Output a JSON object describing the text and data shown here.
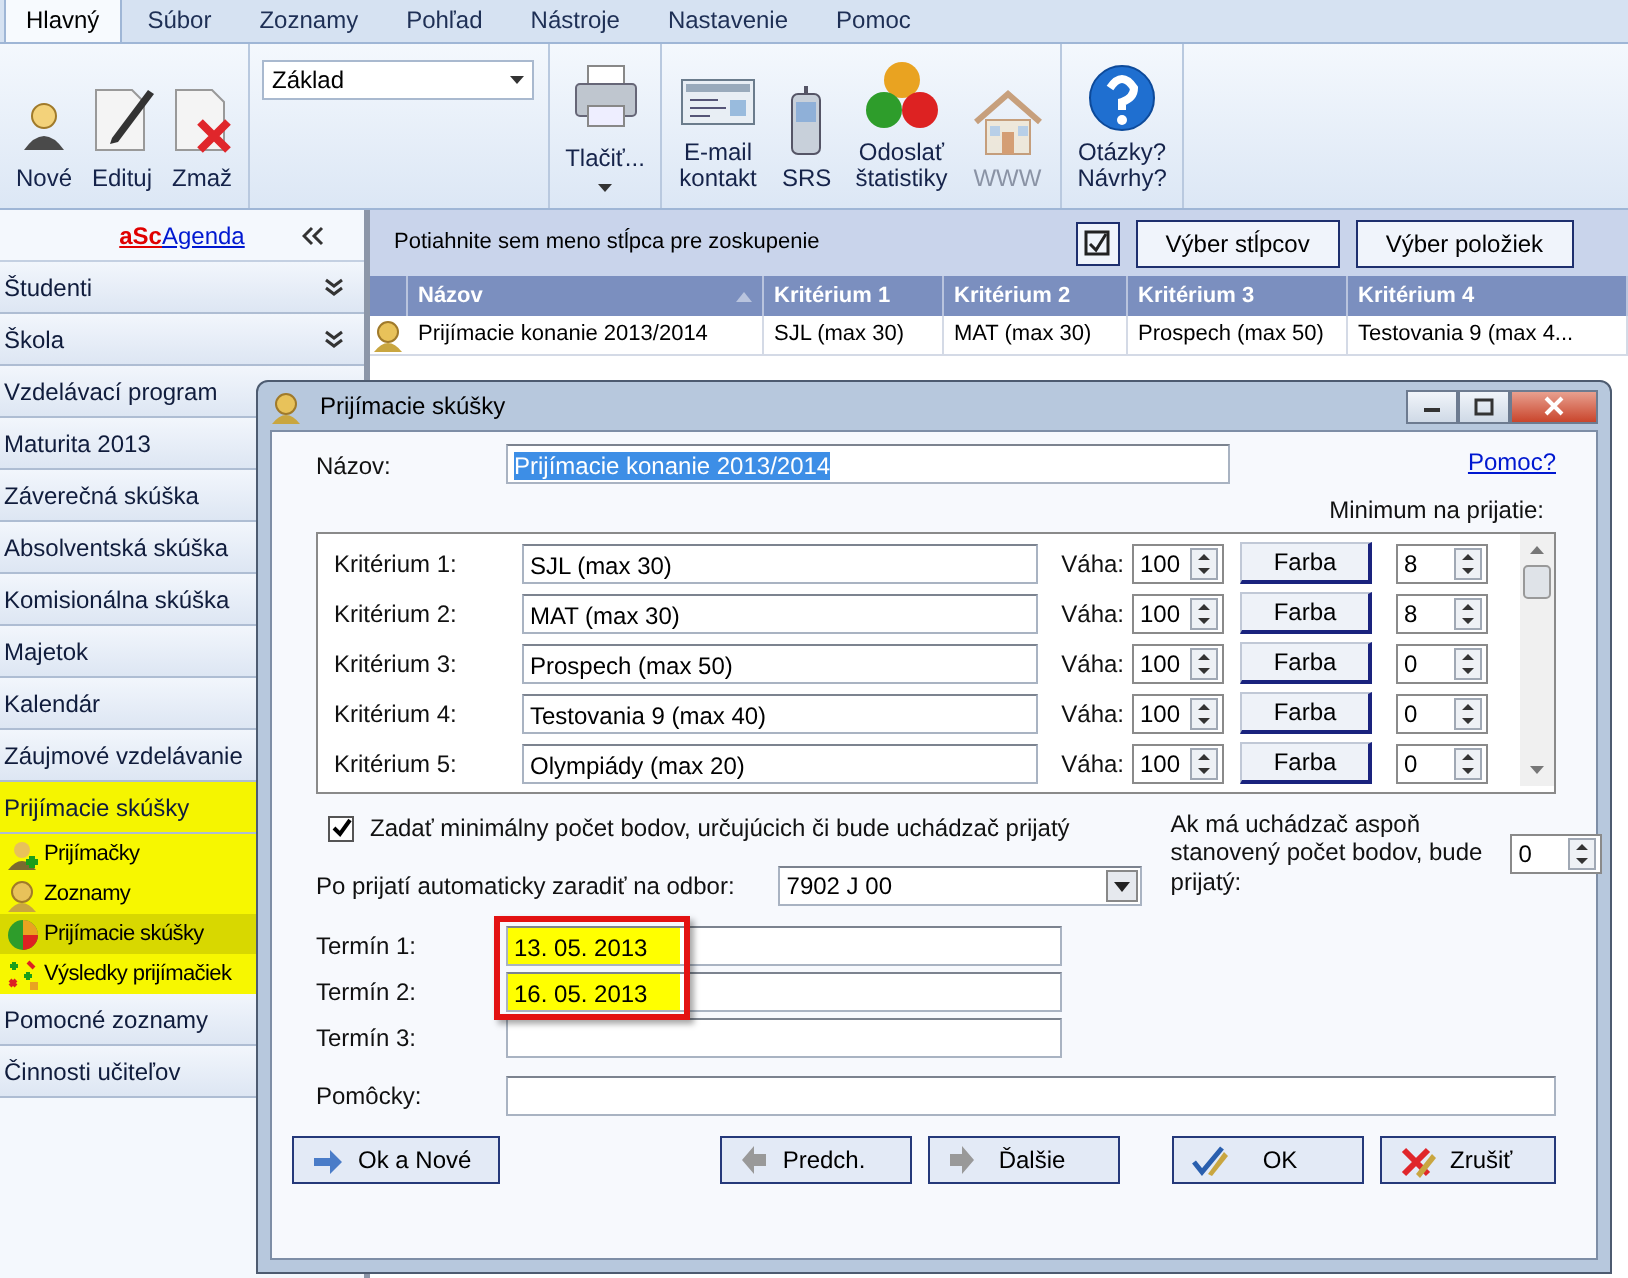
{
  "ribbon": {
    "tabs": [
      {
        "label": "Hlavný",
        "selected": true
      },
      {
        "label": "Súbor",
        "selected": false
      },
      {
        "label": "Zoznamy",
        "selected": false
      },
      {
        "label": "Pohľad",
        "selected": false
      },
      {
        "label": "Nástroje",
        "selected": false
      },
      {
        "label": "Nastavenie",
        "selected": false
      },
      {
        "label": "Pomoc",
        "selected": false
      }
    ],
    "record_buttons": [
      {
        "label": "Nové",
        "kind": "new"
      },
      {
        "label": "Edituj",
        "kind": "edit"
      },
      {
        "label": "Zmaž",
        "kind": "delete"
      }
    ],
    "view_select": {
      "value": "Základ"
    },
    "print_button": {
      "label": "Tlačiť..."
    },
    "tools": [
      {
        "label": "E-mail\nkontakt",
        "kind": "email",
        "disabled": false
      },
      {
        "label": "SRS",
        "kind": "phone",
        "disabled": false
      },
      {
        "label": "Odoslať\nštatistiky",
        "kind": "balls",
        "disabled": false
      },
      {
        "label": "WWW",
        "kind": "house",
        "disabled": true
      }
    ],
    "help_button": {
      "label": "Otázky?\nNávrhy?"
    }
  },
  "sidebar": {
    "brand": "aSc",
    "brand_link": "Agenda",
    "items": [
      {
        "label": "Študenti",
        "collapsible": true,
        "highlighted": false
      },
      {
        "label": "Škola",
        "collapsible": true,
        "highlighted": false
      },
      {
        "label": "Vzdelávací program",
        "highlighted": false
      },
      {
        "label": "Maturita 2013",
        "highlighted": false
      },
      {
        "label": "Záverečná skúška",
        "highlighted": false
      },
      {
        "label": "Absolventská skúška",
        "highlighted": false
      },
      {
        "label": "Komisionálna skúška",
        "highlighted": false
      },
      {
        "label": "Majetok",
        "highlighted": false
      },
      {
        "label": "Kalendár",
        "highlighted": false
      },
      {
        "label": "Záujmové vzdelávanie",
        "highlighted": false
      },
      {
        "label": "Prijímacie skúšky",
        "highlighted": true,
        "expanded": true,
        "children": [
          {
            "label": "Prijímačky",
            "kind": "add-person",
            "selected": false
          },
          {
            "label": "Zoznamy",
            "kind": "person",
            "selected": false
          },
          {
            "label": "Prijímacie skúšky",
            "kind": "ball",
            "selected": true
          },
          {
            "label": "Výsledky prijímačiek",
            "kind": "results",
            "selected": false
          }
        ]
      },
      {
        "label": "Pomocné zoznamy",
        "highlighted": false
      },
      {
        "label": "Činnosti učiteľov",
        "highlighted": false
      }
    ]
  },
  "grid": {
    "group_hint": "Potiahnite sem meno stĺpca pre zoskupenie",
    "buttons": [
      "Výber stĺpcov",
      "Výber položiek"
    ],
    "columns": [
      {
        "label": "Názov",
        "sorted": true
      },
      {
        "label": "Kritérium 1",
        "sorted": false
      },
      {
        "label": "Kritérium 2",
        "sorted": false
      },
      {
        "label": "Kritérium 3",
        "sorted": false
      },
      {
        "label": "Kritérium 4",
        "sorted": false
      }
    ],
    "rows": [
      {
        "cells": [
          "Prijímacie konanie 2013/2014",
          "SJL (max 30)",
          "MAT (max 30)",
          "Prospech (max 50)",
          "Testovania 9 (max 4..."
        ]
      }
    ]
  },
  "dialog": {
    "title": "Prijímacie skúšky",
    "name_label": "Názov:",
    "name_value": "Prijímacie konanie 2013/2014",
    "help_link": "Pomoc?",
    "minimum_label": "Minimum na prijatie:",
    "criteria": [
      {
        "label": "Kritérium 1:",
        "value": "SJL (max 30)",
        "weight_label": "Váha:",
        "weight": "100",
        "color_button": "Farba",
        "minimum": "8"
      },
      {
        "label": "Kritérium 2:",
        "value": "MAT (max 30)",
        "weight_label": "Váha:",
        "weight": "100",
        "color_button": "Farba",
        "minimum": "8"
      },
      {
        "label": "Kritérium 3:",
        "value": "Prospech (max 50)",
        "weight_label": "Váha:",
        "weight": "100",
        "color_button": "Farba",
        "minimum": "0"
      },
      {
        "label": "Kritérium 4:",
        "value": "Testovania 9 (max 40)",
        "weight_label": "Váha:",
        "weight": "100",
        "color_button": "Farba",
        "minimum": "0"
      },
      {
        "label": "Kritérium 5:",
        "value": "Olympiády (max 20)",
        "weight_label": "Váha:",
        "weight": "100",
        "color_button": "Farba",
        "minimum": "0"
      }
    ],
    "min_points_checkbox": {
      "label": "Zadať minimálny počet bodov, určujúcich či bude uchádzač prijatý",
      "checked": true
    },
    "auto_accept": {
      "label": "Ak má uchádzač aspoň stanovený počet bodov, bude prijatý:",
      "value": "0"
    },
    "branch": {
      "label": "Po prijatí automaticky zaradiť na odbor:",
      "value": "7902 J 00"
    },
    "terms": [
      {
        "label": "Termín 1:",
        "value": "13. 05. 2013",
        "highlighted": true
      },
      {
        "label": "Termín 2:",
        "value": "16. 05. 2013",
        "highlighted": true
      },
      {
        "label": "Termín 3:",
        "highlighted": false
      }
    ],
    "aids": {
      "label": "Pomôcky:"
    },
    "buttons": [
      {
        "label": "Ok a Nové",
        "kind": "ok-new"
      },
      {
        "label": "Predch.",
        "kind": "prev"
      },
      {
        "label": "Ďalšie",
        "kind": "next"
      },
      {
        "label": "OK",
        "kind": "ok"
      },
      {
        "label": "Zrušiť",
        "kind": "cancel"
      }
    ]
  }
}
